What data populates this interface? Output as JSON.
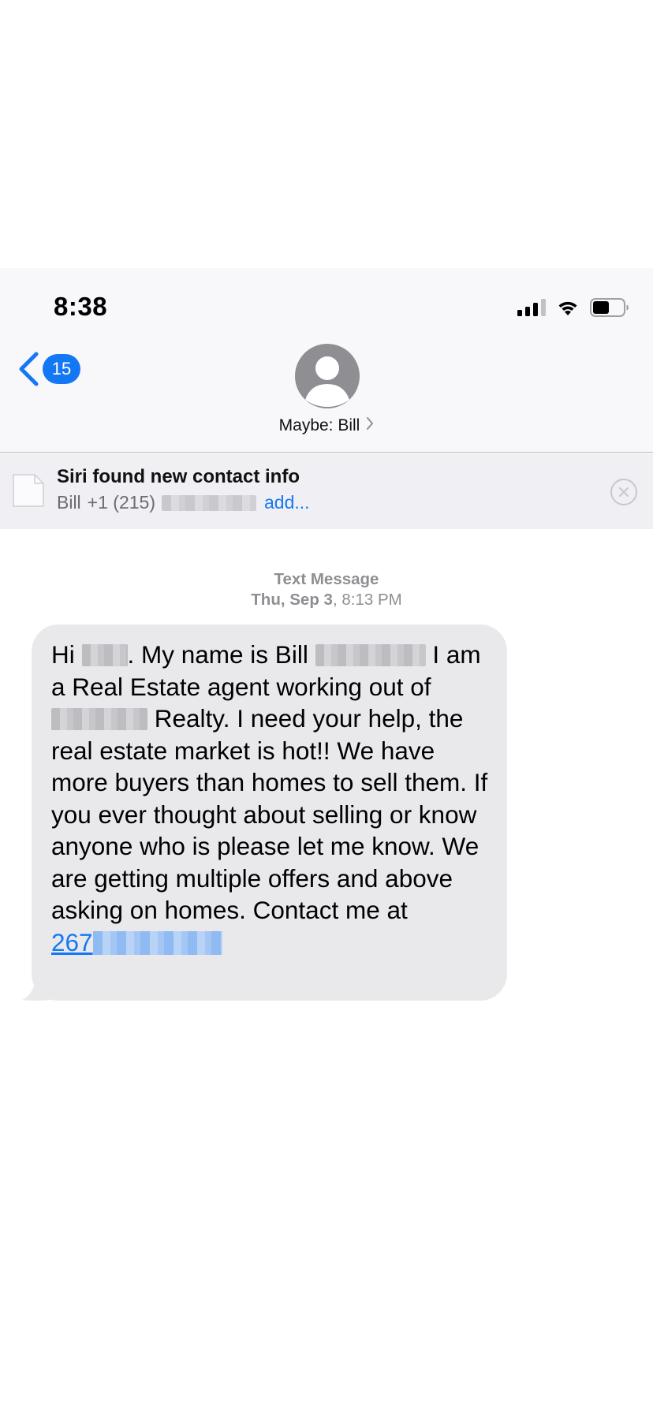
{
  "status_bar": {
    "time": "8:38"
  },
  "nav": {
    "back_badge": "15",
    "contact_name": "Maybe: Bill",
    "icons": {
      "back": "chevron-left-icon",
      "avatar": "person-icon",
      "disclosure": "chevron-right-icon"
    }
  },
  "siri_banner": {
    "title": "Siri found new contact info",
    "name": "Bill",
    "phone_prefix": "+1 (215)",
    "add_label": "add..."
  },
  "conversation": {
    "service_label": "Text Message",
    "date_label": "Thu, Sep 3",
    "time_label": "8:13 PM",
    "message": {
      "greeting": "Hi",
      "intro": ". My name is Bill",
      "line2": "I am a Real Estate agent working out of",
      "line3": "Realty. I need your help, the real estate market is hot!! We have more buyers than homes to sell them. If you ever thought about selling or know anyone who is please let me know. We are getting multiple offers and above asking on homes. Contact me at",
      "phone_prefix": "267"
    }
  },
  "colors": {
    "accent": "#1478f5",
    "bubble": "#e9e9eb",
    "header_bg": "#f8f8fa",
    "banner_bg": "#efeff4",
    "secondary_text": "#8e8e93"
  }
}
